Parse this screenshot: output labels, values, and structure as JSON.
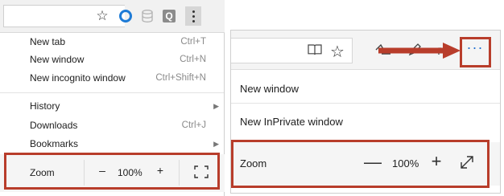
{
  "left": {
    "menu_items": [
      {
        "label": "New tab",
        "shortcut": "Ctrl+T"
      },
      {
        "label": "New window",
        "shortcut": "Ctrl+N"
      },
      {
        "label": "New incognito window",
        "shortcut": "Ctrl+Shift+N"
      },
      {
        "label": "History",
        "shortcut": ""
      },
      {
        "label": "Downloads",
        "shortcut": "Ctrl+J"
      },
      {
        "label": "Bookmarks",
        "shortcut": ""
      }
    ],
    "zoom": {
      "label": "Zoom",
      "minus": "–",
      "value": "100%",
      "plus": "+"
    },
    "icons": [
      "star-icon",
      "opera-icon",
      "database-icon",
      "q-extension-icon",
      "kebab-menu-icon",
      "fullscreen-icon"
    ]
  },
  "right": {
    "menu_items": [
      {
        "label": "New window"
      },
      {
        "label": "New InPrivate window"
      }
    ],
    "zoom": {
      "label": "Zoom",
      "minus": "—",
      "value": "100%",
      "plus": "+"
    },
    "more_label": "···",
    "icons": [
      "reading-view-icon",
      "star-icon",
      "hub-icon",
      "pen-icon",
      "share-icon",
      "more-icon",
      "expand-icon"
    ]
  },
  "colors": {
    "highlight": "#b83d2b",
    "accent_blue": "#1e6ecf"
  }
}
